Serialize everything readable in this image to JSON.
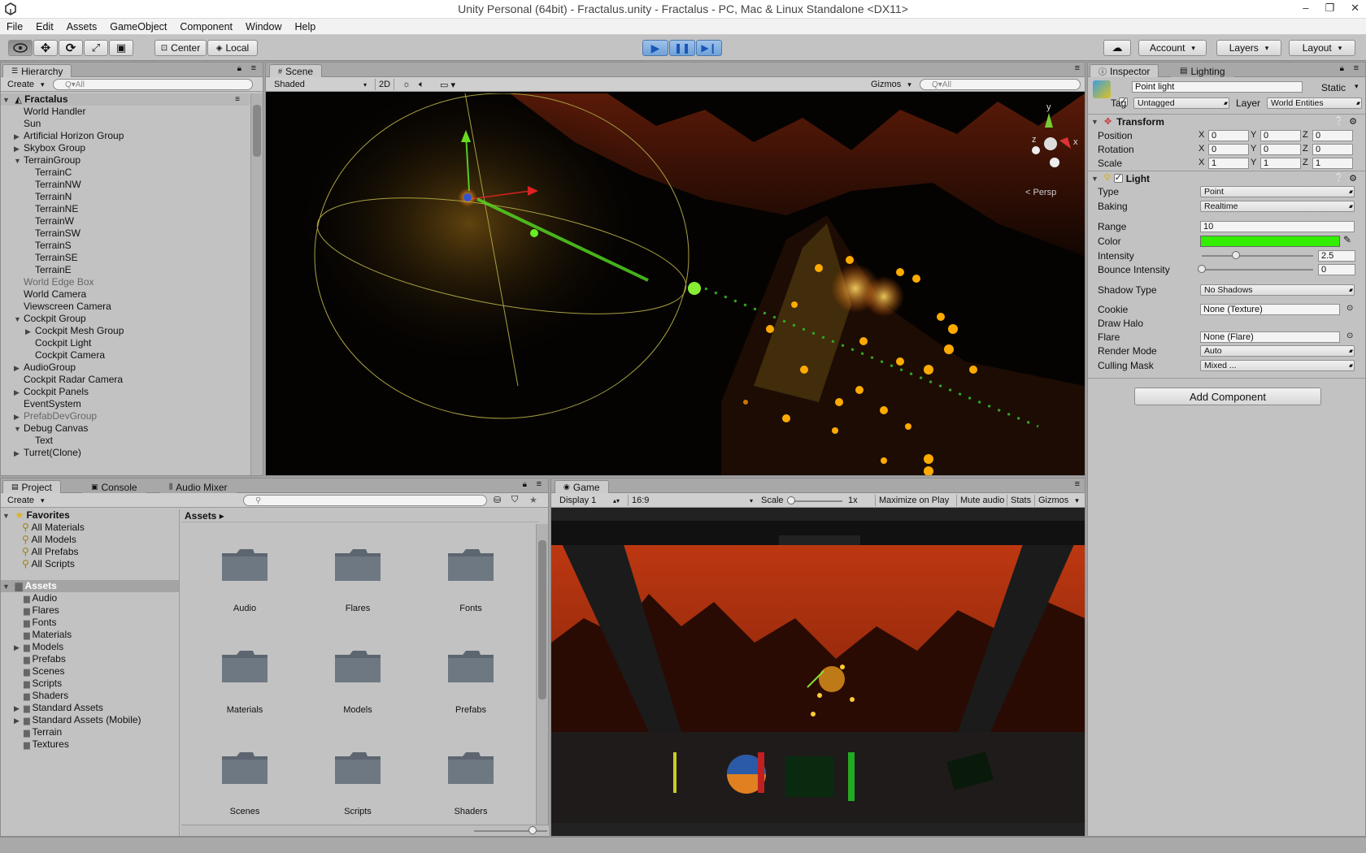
{
  "window": {
    "title": "Unity Personal (64bit) - Fractalus.unity - Fractalus - PC, Mac & Linux Standalone <DX11>",
    "controls": [
      "–",
      "❐",
      "✕"
    ]
  },
  "menu": [
    "File",
    "Edit",
    "Assets",
    "GameObject",
    "Component",
    "Window",
    "Help"
  ],
  "toolbar": {
    "pivot": "Center",
    "space": "Local",
    "account": "Account",
    "layers": "Layers",
    "layout": "Layout"
  },
  "hierarchy": {
    "tab": "Hierarchy",
    "create": "Create",
    "search": "Q▾All",
    "scene": "Fractalus",
    "items": [
      {
        "label": "World Handler",
        "depth": 1,
        "arrow": "",
        "dim": false
      },
      {
        "label": "Sun",
        "depth": 1,
        "arrow": "",
        "dim": false
      },
      {
        "label": "Artificial Horizon Group",
        "depth": 1,
        "arrow": "▶",
        "dim": false
      },
      {
        "label": "Skybox Group",
        "depth": 1,
        "arrow": "▶",
        "dim": false
      },
      {
        "label": "TerrainGroup",
        "depth": 1,
        "arrow": "▼",
        "dim": false
      },
      {
        "label": "TerrainC",
        "depth": 2,
        "arrow": "",
        "dim": false
      },
      {
        "label": "TerrainNW",
        "depth": 2,
        "arrow": "",
        "dim": false
      },
      {
        "label": "TerrainN",
        "depth": 2,
        "arrow": "",
        "dim": false
      },
      {
        "label": "TerrainNE",
        "depth": 2,
        "arrow": "",
        "dim": false
      },
      {
        "label": "TerrainW",
        "depth": 2,
        "arrow": "",
        "dim": false
      },
      {
        "label": "TerrainSW",
        "depth": 2,
        "arrow": "",
        "dim": false
      },
      {
        "label": "TerrainS",
        "depth": 2,
        "arrow": "",
        "dim": false
      },
      {
        "label": "TerrainSE",
        "depth": 2,
        "arrow": "",
        "dim": false
      },
      {
        "label": "TerrainE",
        "depth": 2,
        "arrow": "",
        "dim": false
      },
      {
        "label": "World Edge Box",
        "depth": 1,
        "arrow": "",
        "dim": true
      },
      {
        "label": "World Camera",
        "depth": 1,
        "arrow": "",
        "dim": false
      },
      {
        "label": "Viewscreen Camera",
        "depth": 1,
        "arrow": "",
        "dim": false
      },
      {
        "label": "Cockpit Group",
        "depth": 1,
        "arrow": "▼",
        "dim": false
      },
      {
        "label": "Cockpit Mesh Group",
        "depth": 2,
        "arrow": "▶",
        "dim": false
      },
      {
        "label": "Cockpit Light",
        "depth": 2,
        "arrow": "",
        "dim": false
      },
      {
        "label": "Cockpit Camera",
        "depth": 2,
        "arrow": "",
        "dim": false
      },
      {
        "label": "AudioGroup",
        "depth": 1,
        "arrow": "▶",
        "dim": false
      },
      {
        "label": "Cockpit Radar Camera",
        "depth": 1,
        "arrow": "",
        "dim": false
      },
      {
        "label": "Cockpit Panels",
        "depth": 1,
        "arrow": "▶",
        "dim": false
      },
      {
        "label": "EventSystem",
        "depth": 1,
        "arrow": "",
        "dim": false
      },
      {
        "label": "PrefabDevGroup",
        "depth": 1,
        "arrow": "▶",
        "dim": true
      },
      {
        "label": "Debug Canvas",
        "depth": 1,
        "arrow": "▼",
        "dim": false
      },
      {
        "label": "Text",
        "depth": 2,
        "arrow": "",
        "dim": false
      },
      {
        "label": "Turret(Clone)",
        "depth": 1,
        "arrow": "▶",
        "dim": false
      }
    ]
  },
  "scene": {
    "tab": "Scene",
    "shading": "Shaded",
    "mode2d": "2D",
    "gizmos": "Gizmos",
    "search": "Q▾All",
    "persp": "< Persp",
    "axes": {
      "y": "y",
      "x": "x",
      "z": "z"
    }
  },
  "inspector": {
    "tabs": [
      "Inspector",
      "Lighting"
    ],
    "object_name": "Point light",
    "static": "Static",
    "tag_label": "Tag",
    "tag": "Untagged",
    "layer_label": "Layer",
    "layer": "World Entities",
    "transform": {
      "header": "Transform",
      "rows": [
        {
          "label": "Position",
          "x": "0",
          "y": "0",
          "z": "0"
        },
        {
          "label": "Rotation",
          "x": "0",
          "y": "0",
          "z": "0"
        },
        {
          "label": "Scale",
          "x": "1",
          "y": "1",
          "z": "1"
        }
      ]
    },
    "light": {
      "header": "Light",
      "type_label": "Type",
      "type": "Point",
      "baking_label": "Baking",
      "baking": "Realtime",
      "range_label": "Range",
      "range": "10",
      "color_label": "Color",
      "color": "#33ee00",
      "intensity_label": "Intensity",
      "intensity": "2.5",
      "intensity_fraction": 0.31,
      "bounce_label": "Bounce Intensity",
      "bounce": "0",
      "bounce_fraction": 0.0,
      "shadow_label": "Shadow Type",
      "shadow": "No Shadows",
      "cookie_label": "Cookie",
      "cookie": "None (Texture)",
      "halo_label": "Draw Halo",
      "flare_label": "Flare",
      "flare": "None (Flare)",
      "render_label": "Render Mode",
      "render": "Auto",
      "culling_label": "Culling Mask",
      "culling": "Mixed ..."
    },
    "add_component": "Add Component"
  },
  "project": {
    "tabs": [
      "Project",
      "Console",
      "Audio Mixer"
    ],
    "create": "Create",
    "favorites_label": "Favorites",
    "favorites": [
      "All Materials",
      "All Models",
      "All Prefabs",
      "All Scripts"
    ],
    "assets_label": "Assets",
    "assets_tree": [
      {
        "label": "Audio",
        "arrow": ""
      },
      {
        "label": "Flares",
        "arrow": ""
      },
      {
        "label": "Fonts",
        "arrow": ""
      },
      {
        "label": "Materials",
        "arrow": ""
      },
      {
        "label": "Models",
        "arrow": "▶"
      },
      {
        "label": "Prefabs",
        "arrow": ""
      },
      {
        "label": "Scenes",
        "arrow": ""
      },
      {
        "label": "Scripts",
        "arrow": ""
      },
      {
        "label": "Shaders",
        "arrow": ""
      },
      {
        "label": "Standard Assets",
        "arrow": "▶"
      },
      {
        "label": "Standard Assets (Mobile)",
        "arrow": "▶"
      },
      {
        "label": "Terrain",
        "arrow": ""
      },
      {
        "label": "Textures",
        "arrow": ""
      }
    ],
    "breadcrumb": "Assets ▸",
    "grid": [
      "Audio",
      "Flares",
      "Fonts",
      "Materials",
      "Models",
      "Prefabs",
      "Scenes",
      "Scripts",
      "Shaders"
    ]
  },
  "game": {
    "tab": "Game",
    "display": "Display 1",
    "aspect": "16:9",
    "scale_label": "Scale",
    "scale_value": "1x",
    "maximize": "Maximize on Play",
    "mute": "Mute audio",
    "stats": "Stats",
    "gizmos": "Gizmos"
  }
}
